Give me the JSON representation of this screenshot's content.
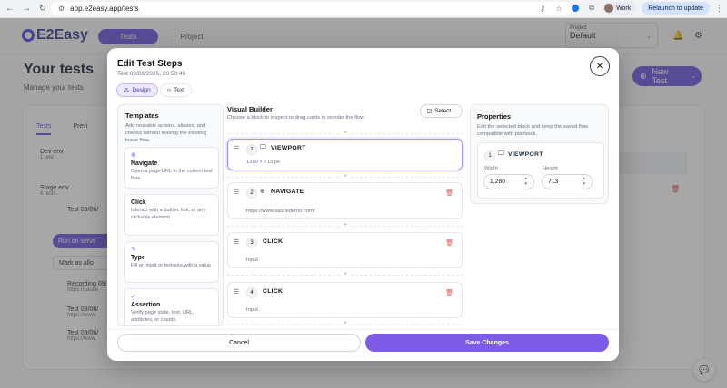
{
  "browser": {
    "url": "app.e2easy.app/tests",
    "profile_label": "Work",
    "relaunch_label": "Relaunch to update",
    "icons": [
      "back-icon",
      "forward-icon",
      "reload-icon",
      "site-info-icon",
      "extension-icon",
      "star-icon",
      "puzzle-icon",
      "menu-icon"
    ]
  },
  "app": {
    "logo": "E2Easy",
    "nav_tabs": [
      {
        "label": "Tests",
        "active": true
      },
      {
        "label": "Project",
        "active": false
      }
    ],
    "project_select": {
      "label": "Project",
      "value": "Default"
    },
    "page_title": "Your tests",
    "page_subtitle": "Manage your tests",
    "new_test_label": "New Test",
    "list_tabs": [
      "Tests",
      "Previ"
    ],
    "rows": [
      {
        "name": "Dev env",
        "sub": "1 test"
      },
      {
        "name": "Stage env",
        "sub": "4 tests"
      },
      {
        "name": "Test 09/06/",
        "sub": ""
      },
      {
        "name": "Recording 09/",
        "sub": "https://sauce"
      },
      {
        "name": "Test 09/06/",
        "sub": "https://www."
      },
      {
        "name": "Test 09/06/",
        "sub": "https://www."
      }
    ],
    "run_label": "Run on serve",
    "mark_label": "Mark as allo"
  },
  "modal": {
    "title": "Edit Test Steps",
    "subtitle": "Test 09/06/2026, 20:50:49",
    "modes": [
      {
        "label": "Design",
        "active": true
      },
      {
        "label": "Text",
        "active": false
      }
    ],
    "templates": {
      "title": "Templates",
      "description": "Add reusable actions, aliases, and checks without leaving the existing linear flow.",
      "items": [
        {
          "name": "Navigate",
          "desc": "Open a page URL in the current test flow.",
          "icon": "globe-icon"
        },
        {
          "name": "Click",
          "desc": "Interact with a button, link, or any clickable element.",
          "icon": ""
        },
        {
          "name": "Type",
          "desc": "Fill an input or textarea with a value.",
          "icon": "pencil-icon"
        },
        {
          "name": "Assertion",
          "desc": "Verify page state, text, URL, attributes, or counts.",
          "icon": "check-circle-icon"
        }
      ]
    },
    "builder": {
      "title": "Visual Builder",
      "description": "Choose a block to inspect or drag cards to reorder the flow.",
      "select_label": "Select...",
      "steps": [
        {
          "num": "1",
          "label": "VIEWPORT",
          "detail": "1280 × 713 px",
          "icon": "monitor-icon",
          "selected": true,
          "deletable": false
        },
        {
          "num": "2",
          "label": "NAVIGATE",
          "detail": "https://www.saucedemo.com/",
          "icon": "globe-icon",
          "selected": false,
          "deletable": true
        },
        {
          "num": "3",
          "label": "CLICK",
          "detail": "Input",
          "icon": "",
          "selected": false,
          "deletable": true
        },
        {
          "num": "4",
          "label": "CLICK",
          "detail": "Input",
          "icon": "",
          "selected": false,
          "deletable": true
        }
      ]
    },
    "properties": {
      "title": "Properties",
      "description": "Edit the selected block and keep the saved flow compatible with playback.",
      "block": {
        "num": "1",
        "label": "VIEWPORT"
      },
      "width_label": "Width",
      "width_value": "1,280",
      "height_label": "Height",
      "height_value": "713"
    },
    "cancel_label": "Cancel",
    "save_label": "Save Changes"
  },
  "colors": {
    "accent": "#7c5ce6",
    "nav_accent": "#6d5ae0",
    "danger": "#e05555"
  }
}
